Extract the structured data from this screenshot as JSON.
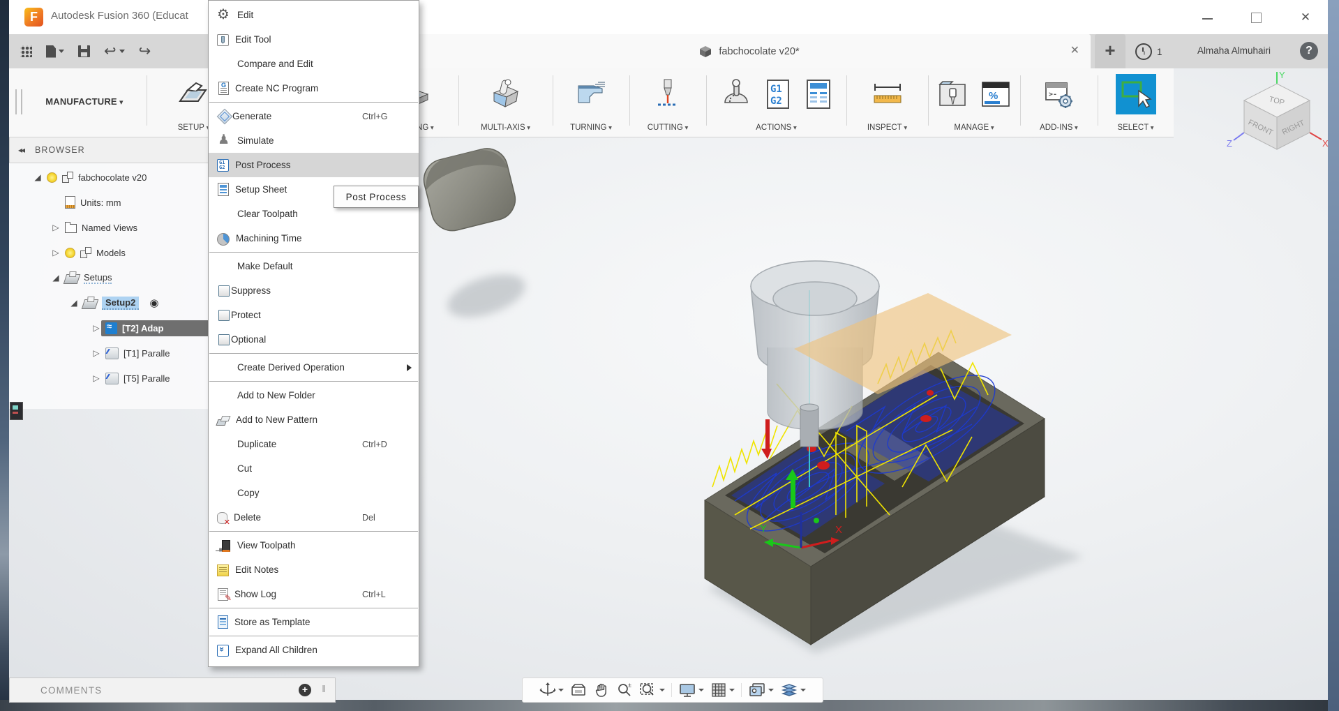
{
  "window": {
    "title": "Autodesk Fusion 360 (Educat",
    "controls": {
      "minimize": "minimize",
      "maximize": "maximize",
      "close": "✕"
    }
  },
  "top_bar": {
    "document_tab": {
      "label": "fabchocolate v20*",
      "close": "✕"
    },
    "new_tab": "+",
    "notification_count": "1",
    "user": "Almaha Almuhairi",
    "help": "?"
  },
  "ribbon": {
    "workspace": "MANUFACTURE",
    "groups": {
      "setup": "SETUP",
      "milling": "MILLING",
      "multi_axis": "MULTI-AXIS",
      "turning": "TURNING",
      "cutting": "CUTTING",
      "actions": "ACTIONS",
      "inspect": "INSPECT",
      "manage": "MANAGE",
      "addins": "ADD-INS",
      "select": "SELECT"
    }
  },
  "browser": {
    "header": "BROWSER",
    "items": [
      {
        "label": "fabchocolate v20",
        "level": 0,
        "expander": "open",
        "icon1": "bulb",
        "icon2": "component"
      },
      {
        "label": "Units: mm",
        "level": 1,
        "expander": "none",
        "icon1": "units-doc"
      },
      {
        "label": "Named Views",
        "level": 1,
        "expander": "closed",
        "icon1": "folder"
      },
      {
        "label": "Models",
        "level": 1,
        "expander": "closed",
        "icon1": "bulb",
        "icon2": "component"
      },
      {
        "label": "Setups",
        "level": 1,
        "expander": "open",
        "icon1": "setup",
        "hatched": true
      },
      {
        "label": "Setup2",
        "level": 2,
        "expander": "open",
        "icon1": "setup",
        "hatched": true,
        "selected": true,
        "target": true
      },
      {
        "label": "[T2] Adap",
        "level": 3,
        "expander": "closed",
        "icon1": "adaptive",
        "active_dark": true
      },
      {
        "label": "[T1] Paralle",
        "level": 3,
        "expander": "closed",
        "icon1": "parallel"
      },
      {
        "label": "[T5] Paralle",
        "level": 3,
        "expander": "closed",
        "icon1": "parallel"
      }
    ],
    "target_glyph": "◉"
  },
  "context_menu": {
    "items": [
      {
        "label": "Edit",
        "icon": "gear"
      },
      {
        "label": "Edit Tool",
        "icon": "edit-tool"
      },
      {
        "label": "Compare and Edit",
        "icon": "none"
      },
      {
        "label": "Create NC Program",
        "icon": "nc-program",
        "sep_after": true
      },
      {
        "label": "Generate",
        "icon": "generate",
        "shortcut": "Ctrl+G"
      },
      {
        "label": "Simulate",
        "icon": "simulate"
      },
      {
        "label": "Post Process",
        "icon": "post-process",
        "highlighted": true
      },
      {
        "label": "Setup Sheet",
        "icon": "setup-sheet"
      },
      {
        "label": "Clear Toolpath",
        "icon": "none"
      },
      {
        "label": "Machining Time",
        "icon": "machining-time",
        "sep_after": true
      },
      {
        "label": "Make Default",
        "icon": "none"
      },
      {
        "label": "Suppress",
        "icon": "checkbox"
      },
      {
        "label": "Protect",
        "icon": "checkbox"
      },
      {
        "label": "Optional",
        "icon": "checkbox",
        "sep_after": true
      },
      {
        "label": "Create Derived Operation",
        "icon": "none",
        "submenu": true,
        "sep_after": true
      },
      {
        "label": "Add to New Folder",
        "icon": "none"
      },
      {
        "label": "Add to New Pattern",
        "icon": "pattern"
      },
      {
        "label": "Duplicate",
        "icon": "none",
        "shortcut": "Ctrl+D"
      },
      {
        "label": "Cut",
        "icon": "none"
      },
      {
        "label": "Copy",
        "icon": "none"
      },
      {
        "label": "Delete",
        "icon": "delete",
        "shortcut": "Del",
        "sep_after": true
      },
      {
        "label": "View Toolpath",
        "icon": "view-toolpath"
      },
      {
        "label": "Edit Notes",
        "icon": "edit-notes"
      },
      {
        "label": "Show Log",
        "icon": "show-log",
        "shortcut": "Ctrl+L",
        "sep_after": true
      },
      {
        "label": "Store as Template",
        "icon": "store-template",
        "sep_after": true
      },
      {
        "label": "Expand All Children",
        "icon": "expand-children"
      }
    ]
  },
  "tooltip": {
    "text": "Post Process"
  },
  "comments": {
    "label": "COMMENTS",
    "add": "+"
  },
  "viewcube": {
    "top": "TOP",
    "front": "FRONT",
    "right": "RIGHT",
    "axis_x": "X",
    "axis_y": "Y",
    "axis_z": "Z"
  },
  "scene_axes": {
    "x": "X",
    "y": "Y"
  },
  "colors": {
    "accent_blue": "#1191d1",
    "toolpath_blue": "#1d3ad0",
    "rapid_yellow": "#f0e400",
    "plunge_red": "#cf1d1d",
    "lead_green": "#19c819",
    "stock_gray": "#67665b",
    "selection_highlight": "#aed3f2"
  }
}
